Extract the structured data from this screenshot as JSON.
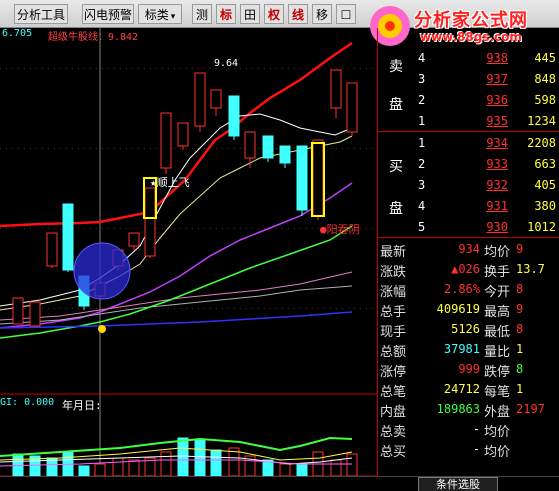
{
  "toolbar": {
    "items": [
      {
        "label": "分析工具",
        "type": "menu"
      },
      {
        "label": "闪电预警",
        "type": "button"
      },
      {
        "label": "标类",
        "type": "menu"
      },
      {
        "label": "测",
        "type": "button"
      },
      {
        "label": "标",
        "type": "button-red"
      },
      {
        "label": "田",
        "type": "button"
      },
      {
        "label": "权",
        "type": "button-red"
      },
      {
        "label": "线",
        "type": "button-red"
      },
      {
        "label": "移",
        "type": "button"
      },
      {
        "label": "☐",
        "type": "button"
      }
    ]
  },
  "logo": {
    "name": "分析家公式网",
    "url": "www.88gs.com"
  },
  "chart": {
    "indicator_label": "超级牛股线：9.842",
    "indicator_value_prefix": "6.705",
    "peak_label": "9.64",
    "signal_up_label": "★顺上飞",
    "signal_down_label": "●阳吞阴",
    "volume_label": "GI: 0.000",
    "date_label": "年月日:"
  },
  "order_book": {
    "sell_side_label": [
      "卖",
      "盘"
    ],
    "buy_side_label": [
      "买",
      "盘"
    ],
    "sells": [
      {
        "level": "4",
        "price": "938",
        "volume": "445"
      },
      {
        "level": "3",
        "price": "937",
        "volume": "848"
      },
      {
        "level": "2",
        "price": "936",
        "volume": "598"
      },
      {
        "level": "1",
        "price": "935",
        "volume": "1234"
      }
    ],
    "buys": [
      {
        "level": "1",
        "price": "934",
        "volume": "2208"
      },
      {
        "level": "2",
        "price": "933",
        "volume": "663"
      },
      {
        "level": "3",
        "price": "932",
        "volume": "405"
      },
      {
        "level": "4",
        "price": "931",
        "volume": "380"
      },
      {
        "level": "5",
        "price": "930",
        "volume": "1012"
      }
    ]
  },
  "stats": [
    {
      "l1": "最新",
      "v1": "934",
      "c1": "#ff3030",
      "l2": "均价",
      "v2": "9",
      "c2": "#ff3030"
    },
    {
      "l1": "涨跌",
      "v1": "▲026",
      "c1": "#ff3030",
      "l2": "换手",
      "v2": "13.7",
      "c2": "#ffff40"
    },
    {
      "l1": "涨幅",
      "v1": "2.86%",
      "c1": "#ff3030",
      "l2": "今开",
      "v2": "8",
      "c2": "#ff3030"
    },
    {
      "l1": "总手",
      "v1": "409619",
      "c1": "#ffff40",
      "l2": "最高",
      "v2": "9",
      "c2": "#ff3030"
    },
    {
      "l1": "现手",
      "v1": "5126",
      "c1": "#ffff40",
      "l2": "最低",
      "v2": "8",
      "c2": "#ff3030"
    },
    {
      "l1": "总额",
      "v1": "37981",
      "c1": "#40ffff",
      "l2": "量比",
      "v2": "1",
      "c2": "#ffff40"
    },
    {
      "l1": "涨停",
      "v1": "999",
      "c1": "#ff3030",
      "l2": "跌停",
      "v2": "8",
      "c2": "#40ff40"
    },
    {
      "l1": "总笔",
      "v1": "24712",
      "c1": "#ffff40",
      "l2": "每笔",
      "v2": "1",
      "c2": "#ffff40"
    },
    {
      "l1": "内盘",
      "v1": "189863",
      "c1": "#40ff40",
      "l2": "外盘",
      "v2": "2197",
      "c2": "#ff3030"
    },
    {
      "l1": "总卖",
      "v1": "-",
      "c1": "#ffffff",
      "l2": "均价",
      "v2": "",
      "c2": "#ffffff"
    },
    {
      "l1": "总买",
      "v1": "-",
      "c1": "#ffffff",
      "l2": "均价",
      "v2": "",
      "c2": "#ffffff"
    }
  ],
  "bottom": {
    "tab_label": "条件选股"
  },
  "colors": {
    "up": "#ff3030",
    "down": "#40ffff",
    "ma_red": "#ff1010",
    "ma_white": "#ffffff",
    "ma_magenta": "#c040ff",
    "ma_green": "#40ff40",
    "ma_blue": "#3030ff"
  }
}
